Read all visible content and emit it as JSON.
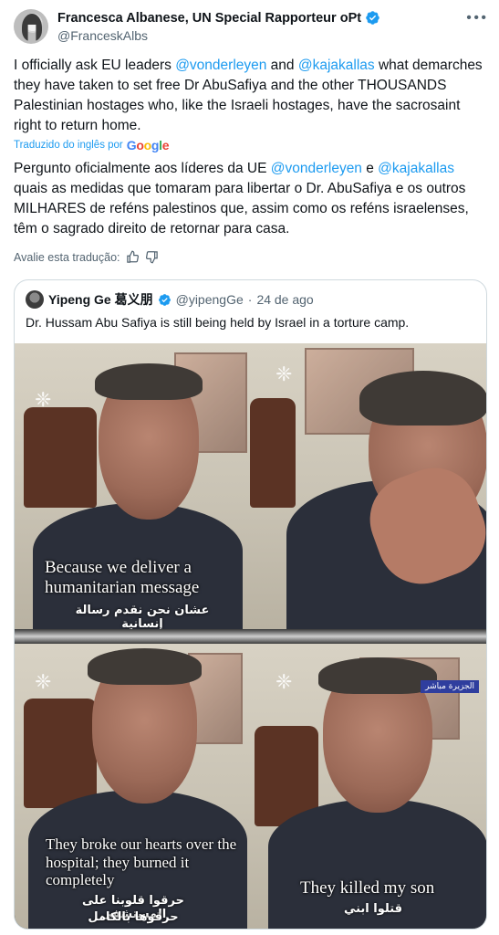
{
  "tweet": {
    "author_name": "Francesca Albanese, UN Special Rapporteur oPt",
    "author_handle": "@FranceskAlbs",
    "original": {
      "p1": "I officially ask EU leaders ",
      "m1": "@vonderleyen",
      "p2": " and ",
      "m2": "@kajakallas",
      "p3": " what demarches they have taken to set free Dr AbuSafiya and the other THOUSANDS Palestinian hostages who, like the Israeli hostages, have the sacrosaint right to return home."
    },
    "translated_by": "Traduzido do inglês por",
    "translated_by_brand": "Google",
    "translation": {
      "p1": "Pergunto oficialmente aos líderes da UE ",
      "m1": "@vonderleyen",
      "p2": " e ",
      "m2": "@kajakallas",
      "p3": " quais as medidas que tomaram para libertar o Dr. AbuSafiya e os outros MILHARES de reféns palestinos que, assim como os reféns israelenses, têm o sagrado direito de retornar para casa."
    },
    "rate_label": "Avalie esta tradução:"
  },
  "quote": {
    "author_name": "Yipeng Ge 葛义朋",
    "author_handle": "@yipengGe",
    "separator": "·",
    "date": "24 de ago",
    "text": "Dr. Hussam Abu Safiya is still being held by Israel in a torture camp.",
    "frames": [
      {
        "caption_en": "Because we deliver a humanitarian message",
        "caption_ar": "عشان نحن نقدم رسالة إنسانية"
      },
      {
        "caption_en": "",
        "caption_ar": ""
      },
      {
        "caption_en": "They broke our hearts over the hospital; they burned it completely",
        "caption_ar": "حرقوا قلوبنا على المستشفى",
        "caption_ar2": "حرقوها بالكامل"
      },
      {
        "caption_en": "They killed my son",
        "caption_ar": "قتلوا ابني",
        "badge": "الجزيرة مباشر"
      }
    ]
  },
  "colors": {
    "accent": "#1d9bf0",
    "text": "#0f1419",
    "muted": "#536471",
    "border": "#cfd9de"
  }
}
